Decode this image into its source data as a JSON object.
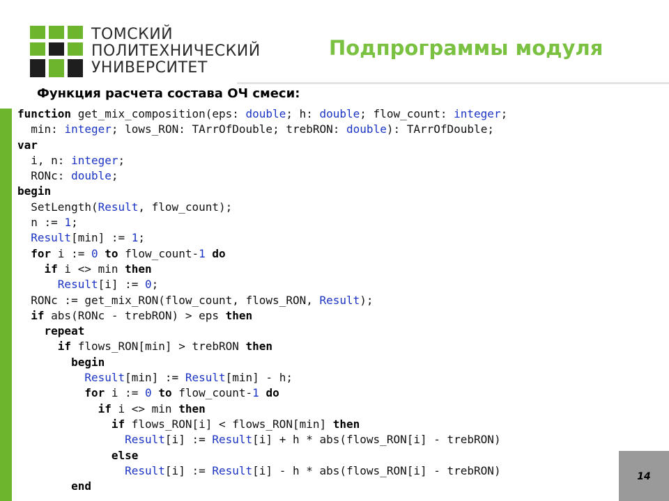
{
  "university": {
    "line1": "ТОМСКИЙ",
    "line2": "ПОЛИТЕХНИЧЕСКИЙ",
    "line3": "УНИВЕРСИТЕТ"
  },
  "slide": {
    "title": "Подпрограммы модуля",
    "subtitle": "Функция расчета состава ОЧ смеси:",
    "page_number": "14"
  },
  "colors": {
    "accent_green": "#6cb52d",
    "title_green": "#7ac142",
    "code_blue": "#1a33c4"
  },
  "code_lines": [
    [
      [
        "kw",
        "function"
      ],
      [
        "t",
        " get_mix_composition(eps: "
      ],
      [
        "b",
        "double"
      ],
      [
        "t",
        "; h: "
      ],
      [
        "b",
        "double"
      ],
      [
        "t",
        "; flow_count: "
      ],
      [
        "b",
        "integer"
      ],
      [
        "t",
        ";"
      ]
    ],
    [
      [
        "t",
        "  min: "
      ],
      [
        "b",
        "integer"
      ],
      [
        "t",
        "; lows_RON: TArrOfDouble; trebRON: "
      ],
      [
        "b",
        "double"
      ],
      [
        "t",
        "): TArrOfDouble;"
      ]
    ],
    [
      [
        "kw",
        "var"
      ]
    ],
    [
      [
        "t",
        "  i, n: "
      ],
      [
        "b",
        "integer"
      ],
      [
        "t",
        ";"
      ]
    ],
    [
      [
        "t",
        "  RONc: "
      ],
      [
        "b",
        "double"
      ],
      [
        "t",
        ";"
      ]
    ],
    [
      [
        "kw",
        "begin"
      ]
    ],
    [
      [
        "t",
        "  SetLength("
      ],
      [
        "b",
        "Result"
      ],
      [
        "t",
        ", flow_count);"
      ]
    ],
    [
      [
        "t",
        "  n := "
      ],
      [
        "b",
        "1"
      ],
      [
        "t",
        ";"
      ]
    ],
    [
      [
        "t",
        "  "
      ],
      [
        "b",
        "Result"
      ],
      [
        "t",
        "[min] := "
      ],
      [
        "b",
        "1"
      ],
      [
        "t",
        ";"
      ]
    ],
    [
      [
        "t",
        "  "
      ],
      [
        "kw",
        "for"
      ],
      [
        "t",
        " i := "
      ],
      [
        "b",
        "0"
      ],
      [
        "t",
        " "
      ],
      [
        "kw",
        "to"
      ],
      [
        "t",
        " flow_count-"
      ],
      [
        "b",
        "1"
      ],
      [
        "t",
        " "
      ],
      [
        "kw",
        "do"
      ]
    ],
    [
      [
        "t",
        "    "
      ],
      [
        "kw",
        "if"
      ],
      [
        "t",
        " i <> min "
      ],
      [
        "kw",
        "then"
      ]
    ],
    [
      [
        "t",
        "      "
      ],
      [
        "b",
        "Result"
      ],
      [
        "t",
        "[i] := "
      ],
      [
        "b",
        "0"
      ],
      [
        "t",
        ";"
      ]
    ],
    [
      [
        "t",
        "  RONc := get_mix_RON(flow_count, flows_RON, "
      ],
      [
        "b",
        "Result"
      ],
      [
        "t",
        ");"
      ]
    ],
    [
      [
        "t",
        "  "
      ],
      [
        "kw",
        "if"
      ],
      [
        "t",
        " abs(RONc - trebRON) > eps "
      ],
      [
        "kw",
        "then"
      ]
    ],
    [
      [
        "t",
        "    "
      ],
      [
        "kw",
        "repeat"
      ]
    ],
    [
      [
        "t",
        "      "
      ],
      [
        "kw",
        "if"
      ],
      [
        "t",
        " flows_RON[min] > trebRON "
      ],
      [
        "kw",
        "then"
      ]
    ],
    [
      [
        "t",
        "        "
      ],
      [
        "kw",
        "begin"
      ]
    ],
    [
      [
        "t",
        "          "
      ],
      [
        "b",
        "Result"
      ],
      [
        "t",
        "[min] := "
      ],
      [
        "b",
        "Result"
      ],
      [
        "t",
        "[min] - h;"
      ]
    ],
    [
      [
        "t",
        "          "
      ],
      [
        "kw",
        "for"
      ],
      [
        "t",
        " i := "
      ],
      [
        "b",
        "0"
      ],
      [
        "t",
        " "
      ],
      [
        "kw",
        "to"
      ],
      [
        "t",
        " flow_count-"
      ],
      [
        "b",
        "1"
      ],
      [
        "t",
        " "
      ],
      [
        "kw",
        "do"
      ]
    ],
    [
      [
        "t",
        "            "
      ],
      [
        "kw",
        "if"
      ],
      [
        "t",
        " i <> min "
      ],
      [
        "kw",
        "then"
      ]
    ],
    [
      [
        "t",
        "              "
      ],
      [
        "kw",
        "if"
      ],
      [
        "t",
        " flows_RON[i] < flows_RON[min] "
      ],
      [
        "kw",
        "then"
      ]
    ],
    [
      [
        "t",
        "                "
      ],
      [
        "b",
        "Result"
      ],
      [
        "t",
        "[i] := "
      ],
      [
        "b",
        "Result"
      ],
      [
        "t",
        "[i] + h * abs(flows_RON[i] - trebRON)"
      ]
    ],
    [
      [
        "t",
        "              "
      ],
      [
        "kw",
        "else"
      ]
    ],
    [
      [
        "t",
        "                "
      ],
      [
        "b",
        "Result"
      ],
      [
        "t",
        "[i] := "
      ],
      [
        "b",
        "Result"
      ],
      [
        "t",
        "[i] - h * abs(flows_RON[i] - trebRON)"
      ]
    ],
    [
      [
        "t",
        "        "
      ],
      [
        "kw",
        "end"
      ]
    ]
  ]
}
